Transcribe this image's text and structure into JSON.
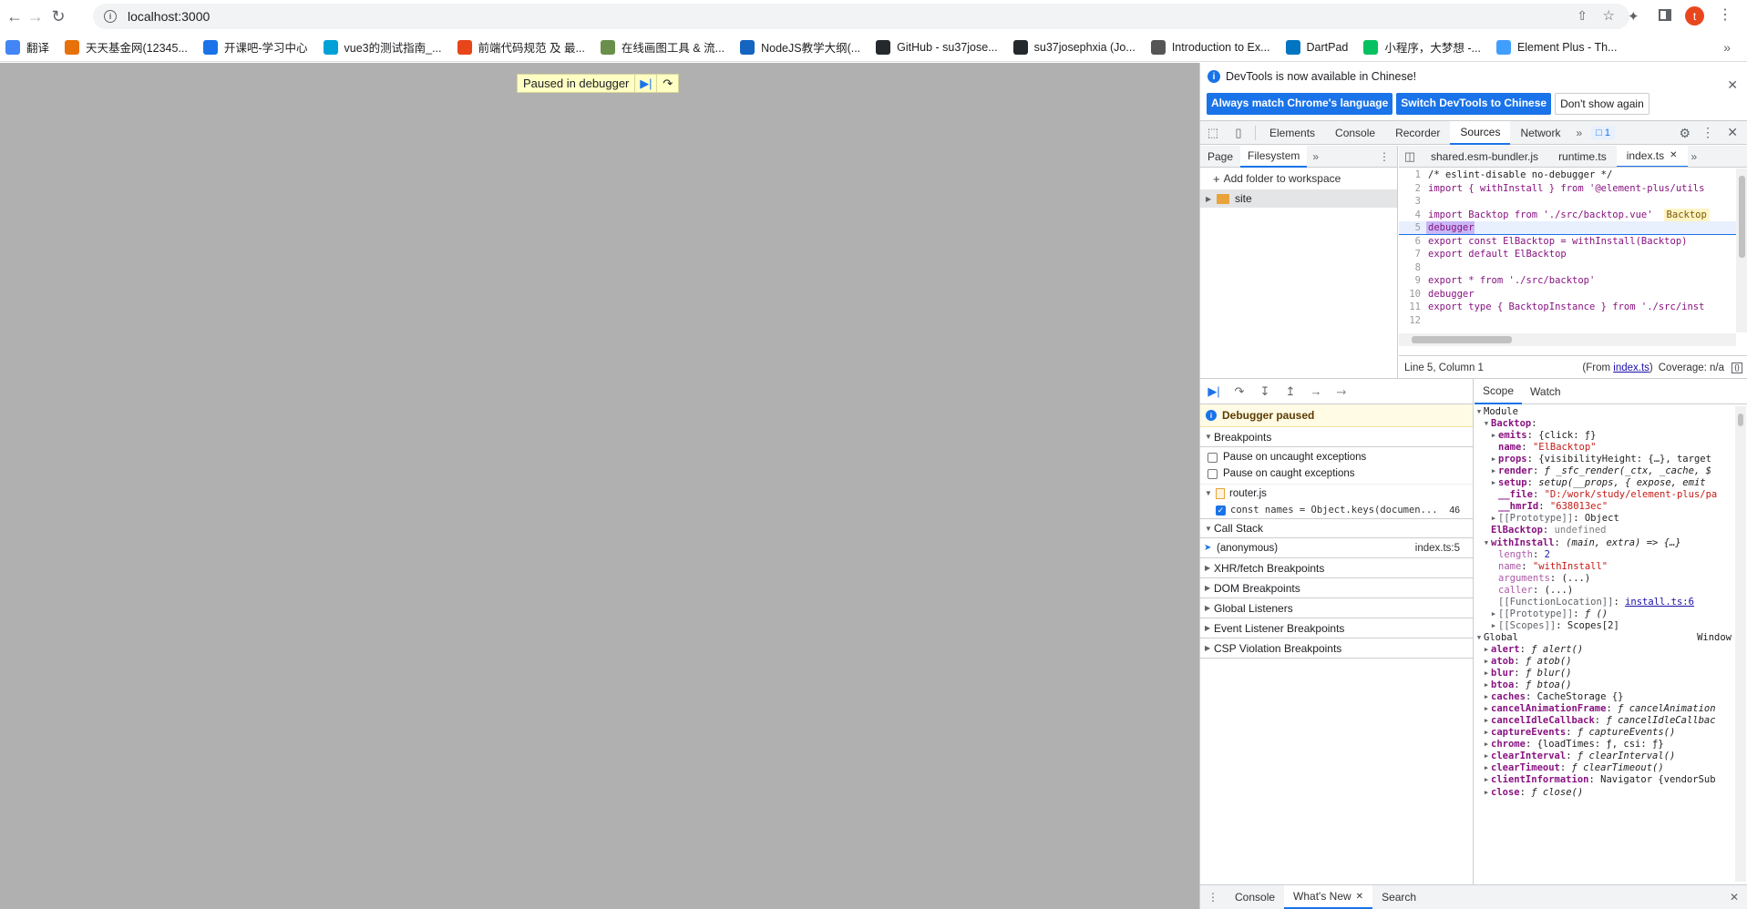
{
  "browser": {
    "url": "localhost:3000",
    "bookmarks": [
      {
        "label": "翻译",
        "color": "#4285f4"
      },
      {
        "label": "天天基金网(12345...",
        "color": "#e8710a"
      },
      {
        "label": "开课吧-学习中心",
        "color": "#1a73e8"
      },
      {
        "label": "vue3的测试指南_...",
        "color": "#00a1d6"
      },
      {
        "label": "前端代码规范 及 最...",
        "color": "#e8451a"
      },
      {
        "label": "在线画图工具 & 流...",
        "color": "#6a8f4b"
      },
      {
        "label": "NodeJS教学大纲(...",
        "color": "#1565c0"
      },
      {
        "label": "GitHub - su37jose...",
        "color": "#24292e"
      },
      {
        "label": "su37josephxia (Jo...",
        "color": "#24292e"
      },
      {
        "label": "Introduction to Ex...",
        "color": "#555555"
      },
      {
        "label": "DartPad",
        "color": "#0175c2"
      },
      {
        "label": "小程序，大梦想 -...",
        "color": "#07c160"
      },
      {
        "label": "Element Plus - Th...",
        "color": "#409eff"
      }
    ],
    "profile_initial": "t"
  },
  "page": {
    "paused_label": "Paused in debugger"
  },
  "devtools": {
    "infobar": {
      "message": "DevTools is now available in Chinese!",
      "btn_always": "Always match Chrome's language",
      "btn_switch": "Switch DevTools to Chinese",
      "btn_dont": "Don't show again"
    },
    "tabs": [
      "Elements",
      "Console",
      "Recorder",
      "Sources",
      "Network"
    ],
    "issues_count": "1",
    "navigator": {
      "tabs": [
        "Page",
        "Filesystem"
      ],
      "add_folder": "Add folder to workspace",
      "folder": "site"
    },
    "editor": {
      "tabs": [
        "shared.esm-bundler.js",
        "runtime.ts",
        "index.ts"
      ],
      "lines": [
        "/* eslint-disable no-debugger */",
        "import { withInstall } from '@element-plus/utils",
        "",
        "import Backtop from './src/backtop.vue'",
        "debugger",
        "export const ElBacktop = withInstall(Backtop)",
        "export default ElBacktop",
        "",
        "export * from './src/backtop'",
        "debugger",
        "export type { BacktopInstance } from './src/inst",
        ""
      ],
      "inline_hint": "Backtop",
      "status_position": "Line 5, Column 1",
      "status_from_prefix": "(From ",
      "status_from_file": "index.ts",
      "status_from_suffix": ")",
      "status_coverage": "Coverage: n/a"
    },
    "debugger": {
      "paused": "Debugger paused",
      "breakpoints": "Breakpoints",
      "pause_uncaught": "Pause on uncaught exceptions",
      "pause_caught": "Pause on caught exceptions",
      "bp_file": "router.js",
      "bp_code": "const names = Object.keys(documen...",
      "bp_line": "46",
      "call_stack": "Call Stack",
      "frame_name": "(anonymous)",
      "frame_loc": "index.ts:5",
      "sections": [
        "XHR/fetch Breakpoints",
        "DOM Breakpoints",
        "Global Listeners",
        "Event Listener Breakpoints",
        "CSP Violation Breakpoints"
      ]
    },
    "scope": {
      "tabs": [
        "Scope",
        "Watch"
      ],
      "module_label": "Module",
      "global_label": "Global",
      "global_value": "Window",
      "rows": [
        {
          "indent": 1,
          "tri": "▼",
          "name": "Backtop",
          "sep": ":",
          "value": "",
          "cls": "pv"
        },
        {
          "indent": 2,
          "tri": "▶",
          "name": "emits",
          "sep": ": ",
          "value": "{click: ƒ}",
          "cls": "pv"
        },
        {
          "indent": 2,
          "tri": "",
          "name": "name",
          "sep": ": ",
          "value": "\"ElBacktop\"",
          "cls": "pvs"
        },
        {
          "indent": 2,
          "tri": "▶",
          "name": "props",
          "sep": ": ",
          "value": "{visibilityHeight: {…}, target",
          "cls": "pv"
        },
        {
          "indent": 2,
          "tri": "▶",
          "name": "render",
          "sep": ": ",
          "value": "ƒ _sfc_render(_ctx, _cache, $",
          "cls": "pvi"
        },
        {
          "indent": 2,
          "tri": "▶",
          "name": "setup",
          "sep": ": ",
          "value": "setup(__props, { expose, emit",
          "cls": "pvi"
        },
        {
          "indent": 2,
          "tri": "",
          "name": "__file",
          "sep": ": ",
          "value": "\"D:/work/study/element-plus/pa",
          "cls": "pvs"
        },
        {
          "indent": 2,
          "tri": "",
          "name": "__hmrId",
          "sep": ": ",
          "value": "\"638013ec\"",
          "cls": "pvs"
        },
        {
          "indent": 2,
          "tri": "▶",
          "name": "[[Prototype]]",
          "sep": ": ",
          "value": "Object",
          "cls": "pv",
          "dim": true
        },
        {
          "indent": 1,
          "tri": "",
          "name": "ElBacktop",
          "sep": ": ",
          "value": "undefined",
          "cls": "pv",
          "grey": true
        },
        {
          "indent": 1,
          "tri": "▼",
          "name": "withInstall",
          "sep": ": ",
          "value": "(main, extra) => {…}",
          "cls": "pvi"
        },
        {
          "indent": 2,
          "tri": "",
          "name": "length",
          "sep": ": ",
          "value": "2",
          "cls": "pvn",
          "dim": true
        },
        {
          "indent": 2,
          "tri": "",
          "name": "name",
          "sep": ": ",
          "value": "\"withInstall\"",
          "cls": "pvs",
          "dim": true
        },
        {
          "indent": 2,
          "tri": "",
          "name": "arguments",
          "sep": ": ",
          "value": "(...)",
          "cls": "pv",
          "dim": true
        },
        {
          "indent": 2,
          "tri": "",
          "name": "caller",
          "sep": ": ",
          "value": "(...)",
          "cls": "pv",
          "dim": true
        },
        {
          "indent": 2,
          "tri": "",
          "name": "[[FunctionLocation]]",
          "sep": ": ",
          "value": "install.ts:6",
          "cls": "lnk",
          "dim": true
        },
        {
          "indent": 2,
          "tri": "▶",
          "name": "[[Prototype]]",
          "sep": ": ",
          "value": "ƒ ()",
          "cls": "pvi",
          "dim": true
        },
        {
          "indent": 2,
          "tri": "▶",
          "name": "[[Scopes]]",
          "sep": ": ",
          "value": "Scopes[2]",
          "cls": "pv",
          "dim": true
        }
      ],
      "global_rows": [
        {
          "name": "alert",
          "value": "ƒ alert()"
        },
        {
          "name": "atob",
          "value": "ƒ atob()"
        },
        {
          "name": "blur",
          "value": "ƒ blur()"
        },
        {
          "name": "btoa",
          "value": "ƒ btoa()"
        },
        {
          "name": "caches",
          "value": "CacheStorage {}"
        },
        {
          "name": "cancelAnimationFrame",
          "value": "ƒ cancelAnimation"
        },
        {
          "name": "cancelIdleCallback",
          "value": "ƒ cancelIdleCallbac"
        },
        {
          "name": "captureEvents",
          "value": "ƒ captureEvents()"
        },
        {
          "name": "chrome",
          "value": "{loadTimes: ƒ, csi: ƒ}"
        },
        {
          "name": "clearInterval",
          "value": "ƒ clearInterval()"
        },
        {
          "name": "clearTimeout",
          "value": "ƒ clearTimeout()"
        },
        {
          "name": "clientInformation",
          "value": "Navigator {vendorSub"
        },
        {
          "name": "close",
          "value": "ƒ close()"
        }
      ]
    },
    "drawer": {
      "tabs": [
        "Console",
        "What's New",
        "Search"
      ]
    }
  }
}
